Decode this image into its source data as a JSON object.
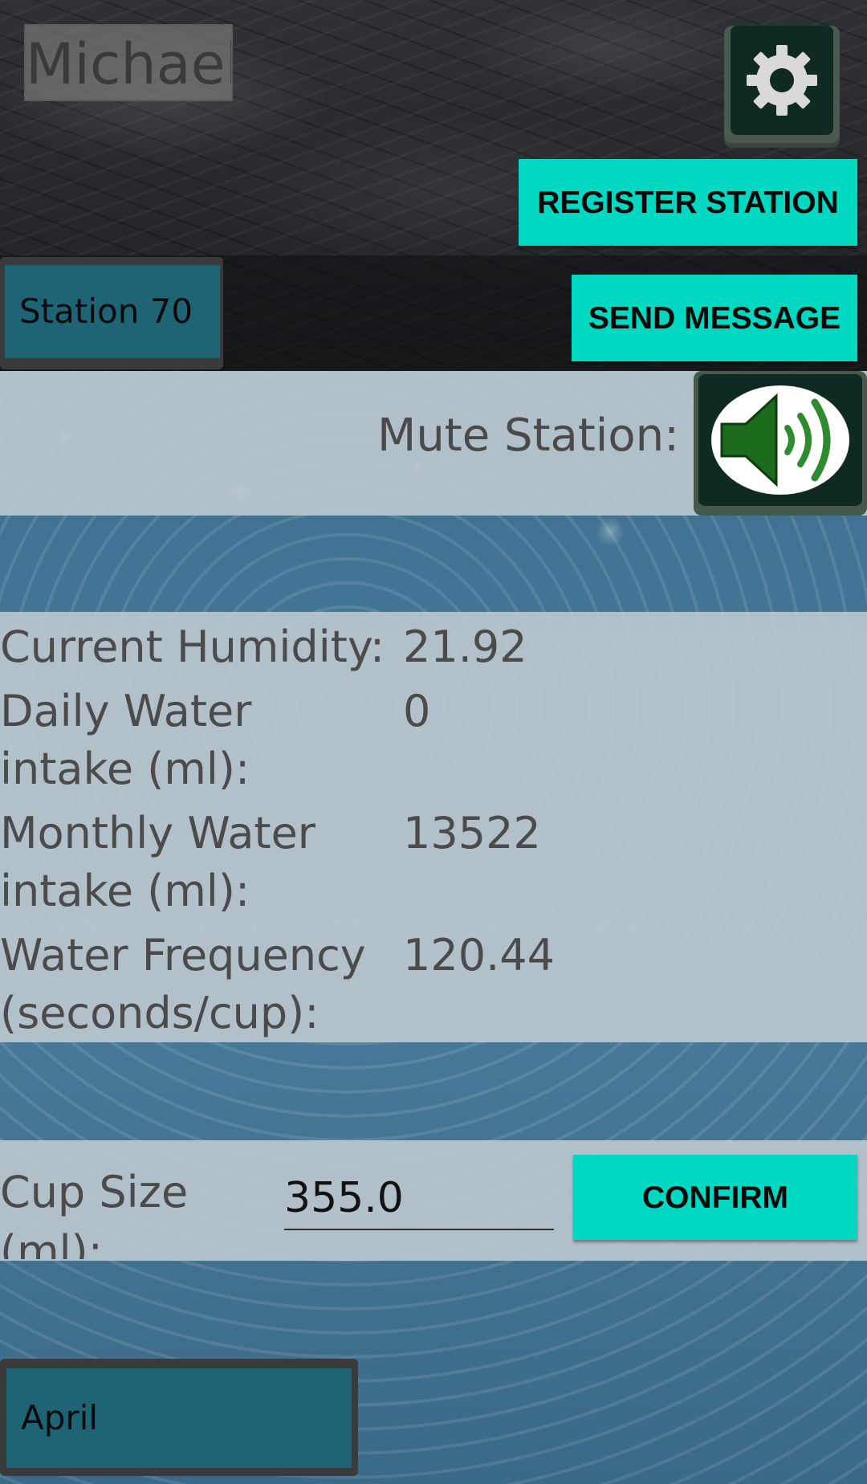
{
  "header": {
    "user_name": "Michael",
    "settings_icon": "gear-icon",
    "register_label": "REGISTER STATION",
    "message_label": "SEND MESSAGE",
    "station_selected": "Station 70"
  },
  "mute": {
    "label": "Mute Station:",
    "icon": "speaker-volume-icon"
  },
  "stats": [
    {
      "label": "Current Humidity:",
      "value": "21.92"
    },
    {
      "label": "Daily Water intake (ml):",
      "value": "0"
    },
    {
      "label": "Monthly Water intake (ml):",
      "value": "13522"
    },
    {
      "label": "Water Frequency (seconds/cup):",
      "value": "120.44"
    }
  ],
  "cup": {
    "label": "Cup Size (ml):",
    "value": "355.0",
    "confirm_label": "CONFIRM"
  },
  "month": {
    "selected": "April"
  },
  "colors": {
    "accent": "#00d8c2",
    "dropdown": "#1f6475",
    "icon_bg": "#0f2a22",
    "speaker_green": "#2e8b2e"
  }
}
